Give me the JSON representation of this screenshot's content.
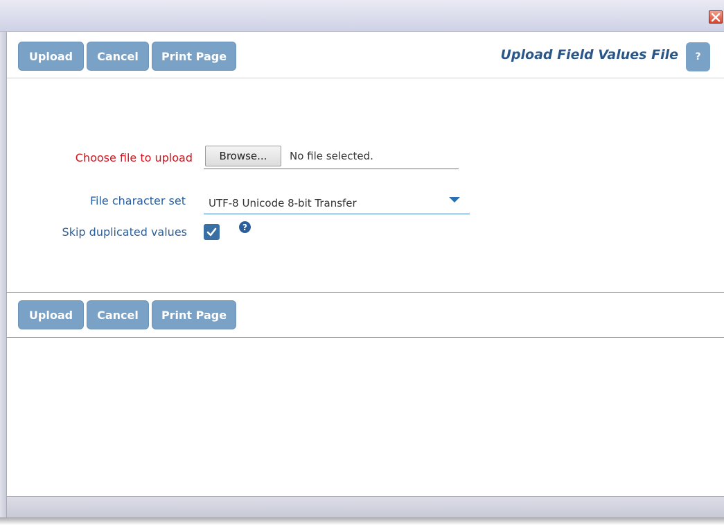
{
  "dialog": {
    "title": "Upload Field Values File",
    "help_label": "?",
    "close_icon": "close-x-icon"
  },
  "toolbar_top": {
    "upload_label": "Upload",
    "cancel_label": "Cancel",
    "print_label": "Print Page"
  },
  "toolbar_bottom": {
    "upload_label": "Upload",
    "cancel_label": "Cancel",
    "print_label": "Print Page"
  },
  "form": {
    "file_label": "Choose file to upload",
    "browse_label": "Browse...",
    "file_status": "No file selected.",
    "charset_label": "File character set",
    "charset_value": "UTF-8 Unicode 8-bit Transfer",
    "skip_label": "Skip duplicated values",
    "skip_checked": true,
    "info_icon": "?"
  },
  "colors": {
    "button_bg": "#7aa2c6",
    "title_color": "#2a5788",
    "required_label": "#d8121c",
    "label": "#2a5f9c"
  }
}
